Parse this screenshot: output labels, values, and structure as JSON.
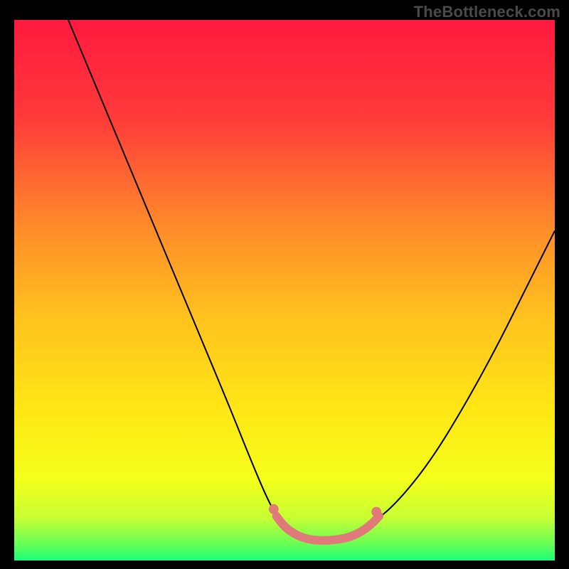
{
  "watermark": "TheBottleneck.com",
  "chart_data": {
    "type": "line",
    "title": "",
    "xlabel": "",
    "ylabel": "",
    "xlim": [
      0,
      100
    ],
    "ylim": [
      0,
      100
    ],
    "grid": false,
    "axes_visible": false,
    "background_gradient": {
      "stops": [
        {
          "pos": 0.0,
          "color": "#ff1a3f"
        },
        {
          "pos": 0.18,
          "color": "#ff3a3a"
        },
        {
          "pos": 0.38,
          "color": "#ff8a2a"
        },
        {
          "pos": 0.55,
          "color": "#ffc21e"
        },
        {
          "pos": 0.72,
          "color": "#ffe615"
        },
        {
          "pos": 0.85,
          "color": "#f4ff1a"
        },
        {
          "pos": 0.92,
          "color": "#c8ff33"
        },
        {
          "pos": 0.97,
          "color": "#66ff55"
        },
        {
          "pos": 1.0,
          "color": "#1aff7a"
        }
      ]
    },
    "series": [
      {
        "name": "left-branch",
        "color": "#000000",
        "width": 2,
        "x": [
          10.0,
          15.0,
          20.0,
          25.0,
          30.0,
          35.0,
          40.0,
          44.0,
          47.0,
          49.0
        ],
        "y": [
          100.0,
          88.0,
          76.0,
          64.0,
          52.0,
          40.0,
          28.0,
          18.0,
          11.0,
          7.5
        ]
      },
      {
        "name": "right-branch",
        "color": "#000000",
        "width": 2,
        "x": [
          67.0,
          70.0,
          74.0,
          78.0,
          82.0,
          86.0,
          90.0,
          94.0,
          97.0,
          100.0
        ],
        "y": [
          7.5,
          10.0,
          14.5,
          20.0,
          26.5,
          33.5,
          41.0,
          49.0,
          55.0,
          61.0
        ]
      },
      {
        "name": "valley-band",
        "color": "#e07a7a",
        "width": 12,
        "linecap": "round",
        "x": [
          48.5,
          50.0,
          52.0,
          54.0,
          56.0,
          58.0,
          60.0,
          62.0,
          64.0,
          66.0,
          67.5
        ],
        "y": [
          8.2,
          6.2,
          4.8,
          4.0,
          3.7,
          3.7,
          3.9,
          4.3,
          5.2,
          6.6,
          8.2
        ]
      },
      {
        "name": "valley-endpoints",
        "type": "scatter",
        "color": "#e07a7a",
        "radius": 7,
        "x": [
          48.0,
          67.0
        ],
        "y": [
          9.5,
          9.0
        ]
      }
    ]
  }
}
